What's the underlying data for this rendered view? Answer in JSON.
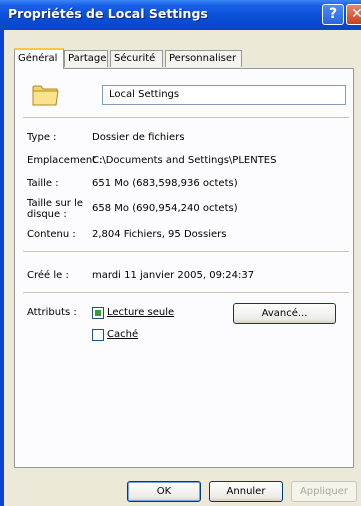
{
  "window": {
    "title": "Propriétés de Local Settings",
    "help_glyph": "?",
    "close_glyph": "✕"
  },
  "tabs": [
    {
      "label": "Général",
      "active": true
    },
    {
      "label": "Partage",
      "active": false
    },
    {
      "label": "Sécurité",
      "active": false
    },
    {
      "label": "Personnaliser",
      "active": false
    }
  ],
  "general": {
    "folder_icon": "folder-icon",
    "name_value": "Local Settings",
    "type_label": "Type :",
    "type_value": "Dossier de fichiers",
    "location_label": "Emplacement :",
    "location_value": "C:\\Documents and Settings\\PLENTES",
    "size_label": "Taille :",
    "size_value": "651 Mo (683,598,936 octets)",
    "size_on_disk_label_1": "Taille sur le",
    "size_on_disk_label_2": "disque :",
    "size_on_disk_value": "658 Mo (690,954,240 octets)",
    "contents_label": "Contenu :",
    "contents_value": "2,804 Fichiers, 95 Dossiers",
    "created_label": "Créé le :",
    "created_value": "mardi 11 janvier 2005, 09:24:37",
    "attributes_label": "Attributs :",
    "readonly_label": "Lecture seule",
    "readonly_state": "indeterminate",
    "hidden_label": "Caché",
    "hidden_checked": false,
    "advanced_button": "Avancé..."
  },
  "footer": {
    "ok": "OK",
    "cancel": "Annuler",
    "apply": "Appliquer"
  },
  "colors": {
    "titlebar": "#0a4fd8",
    "dialog_bg": "#ece9d8",
    "active_tab_highlight": "#ffc83c"
  }
}
